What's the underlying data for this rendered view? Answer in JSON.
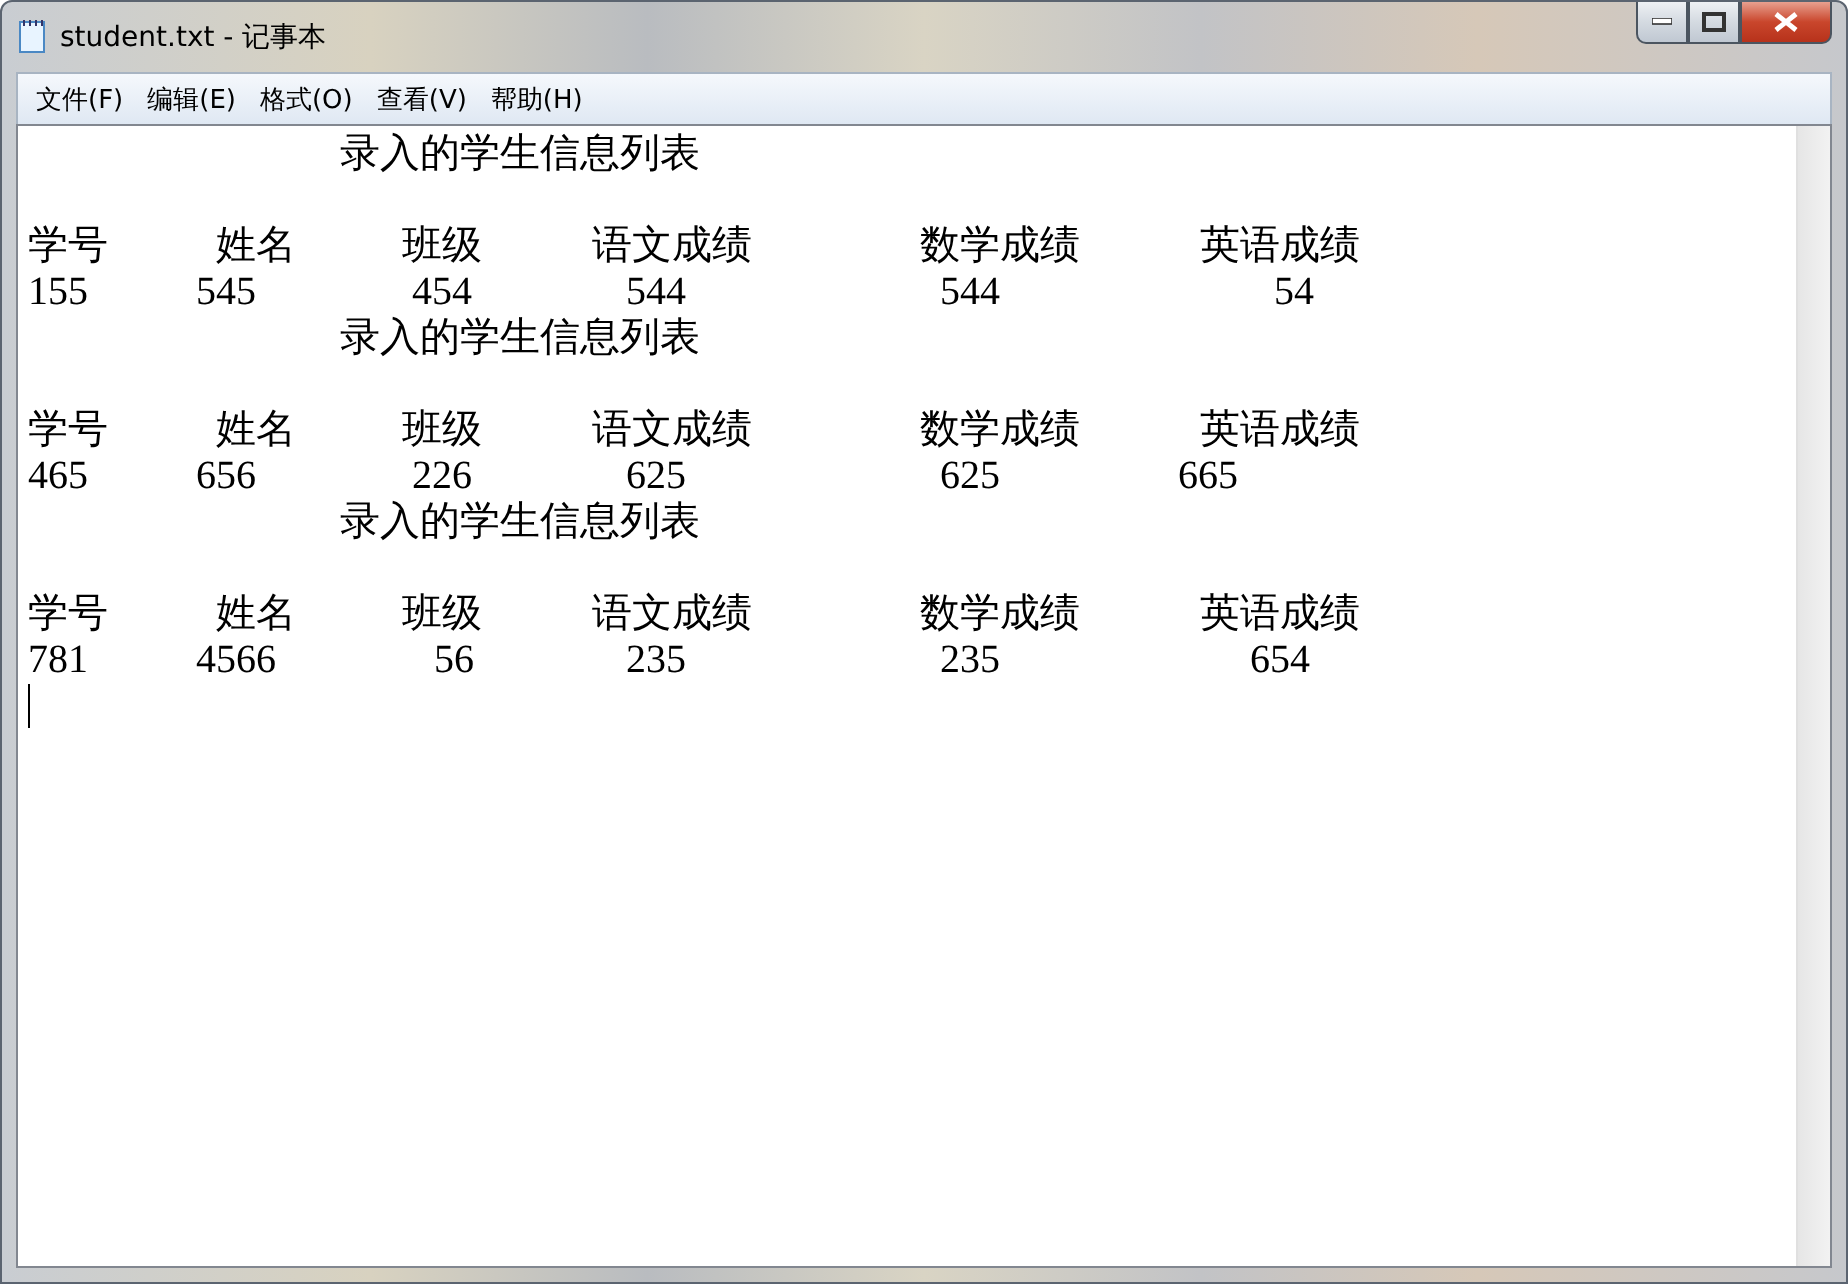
{
  "window": {
    "title": "student.txt - 记事本"
  },
  "menu": [
    "文件(F)",
    "编辑(E)",
    "格式(O)",
    "查看(V)",
    "帮助(H)"
  ],
  "lines": [
    {
      "kind": "title",
      "text": "录入的学生信息列表"
    },
    {
      "kind": "blank"
    },
    {
      "kind": "header",
      "cells": [
        "学号",
        "姓名",
        "班级",
        "语文成绩",
        "数学成绩",
        "英语成绩"
      ]
    },
    {
      "kind": "values",
      "cells": [
        "155",
        "545",
        "454",
        "544",
        "544",
        "54"
      ]
    },
    {
      "kind": "title",
      "text": "录入的学生信息列表"
    },
    {
      "kind": "blank"
    },
    {
      "kind": "header",
      "cells": [
        "学号",
        "姓名",
        "班级",
        "语文成绩",
        "数学成绩",
        "英语成绩"
      ]
    },
    {
      "kind": "values",
      "cells": [
        "465",
        "656",
        "226",
        "625",
        "625",
        "665"
      ]
    },
    {
      "kind": "title",
      "text": "录入的学生信息列表"
    },
    {
      "kind": "blank"
    },
    {
      "kind": "header",
      "cells": [
        "学号",
        "姓名",
        "班级",
        "语文成绩",
        "数学成绩",
        "英语成绩"
      ]
    },
    {
      "kind": "values",
      "cells": [
        "781",
        "4566",
        "56",
        "235",
        "235",
        "654"
      ]
    },
    {
      "kind": "caret"
    }
  ]
}
